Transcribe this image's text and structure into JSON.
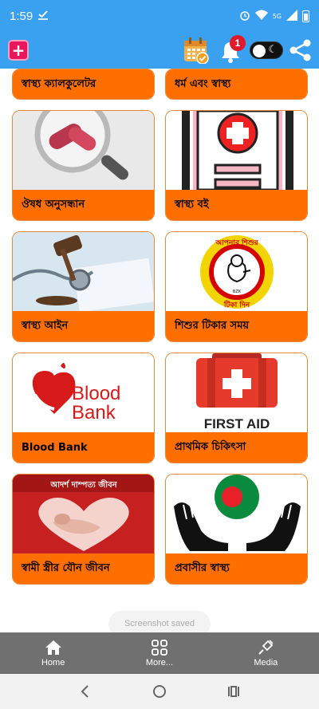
{
  "status_bar": {
    "time": "1:59",
    "network": "5G"
  },
  "app_bar": {
    "notification_count": "1"
  },
  "cards": [
    {
      "label": "স্বাস্থ্য ক্যালকুলেটর",
      "icon": "calculator"
    },
    {
      "label": "ধর্ম এবং স্বাস্থ্য",
      "icon": "religion"
    },
    {
      "label": "ঔষধ অনুসন্ধান",
      "icon": "medicine-search"
    },
    {
      "label": "স্বাস্থ্য বই",
      "icon": "health-book"
    },
    {
      "label": "স্বাস্থ্য আইন",
      "icon": "health-law"
    },
    {
      "label": "শিশুর টিকার সময়",
      "icon": "child-vaccine"
    },
    {
      "label": "Blood Bank",
      "icon": "blood-bank"
    },
    {
      "label": "প্রাথমিক চিকিৎসা",
      "icon": "first-aid"
    },
    {
      "label": "স্বামী স্ত্রীর যৌন জীবন",
      "icon": "couple-life"
    },
    {
      "label": "প্রবাসীর স্বাস্থ্য",
      "icon": "expatriate-health"
    }
  ],
  "card_images": {
    "blood_bank_line1": "Blood",
    "blood_bank_line2": "Bank",
    "first_aid": "FIRST AID",
    "vaccine_ring_top": "আপনার শিশুর",
    "vaccine_ring_bottom": "টিকা দিন",
    "vaccine_center": "BZK",
    "couple_book_top": "আদর্শ দাম্পত্য জীবন"
  },
  "toast": "Screenshot saved",
  "bottom_nav": [
    {
      "label": "Home"
    },
    {
      "label": "More..."
    },
    {
      "label": "Media"
    }
  ],
  "colors": {
    "primary": "#3aa0f0",
    "accent": "#ff6f00",
    "nav_bg": "#707070"
  }
}
